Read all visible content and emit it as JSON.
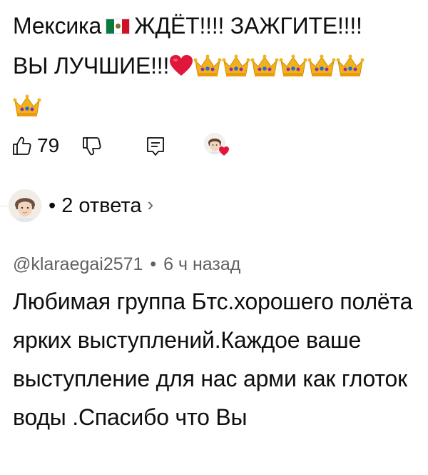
{
  "comment": {
    "text_part1": "Мексика",
    "text_part2": "ЖДЁТ!!!! ЗАЖГИТЕ!!!!",
    "text_part3": "ВЫ ЛУЧШИЕ!!!",
    "emojis": [
      "mexico-flag",
      "red-heart",
      "crown",
      "crown",
      "crown",
      "crown",
      "crown",
      "crown",
      "crown"
    ],
    "like_count": "79"
  },
  "replies": {
    "label": "• 2 ответа",
    "chevron": "›"
  },
  "reply": {
    "author": "@klaraegai2571",
    "separator": "•",
    "time": "6 ч назад",
    "text": "Любимая группа Бтс.хорошего полёта ярких выступлений.Каждое ваше выступление для нас арми как глоток воды .Спасибо что Вы"
  },
  "colors": {
    "text": "#0f0f0f",
    "secondary": "#606060",
    "heart": "#e0173a",
    "crown": "#f4b21a",
    "gem": "#8e2bbf"
  }
}
